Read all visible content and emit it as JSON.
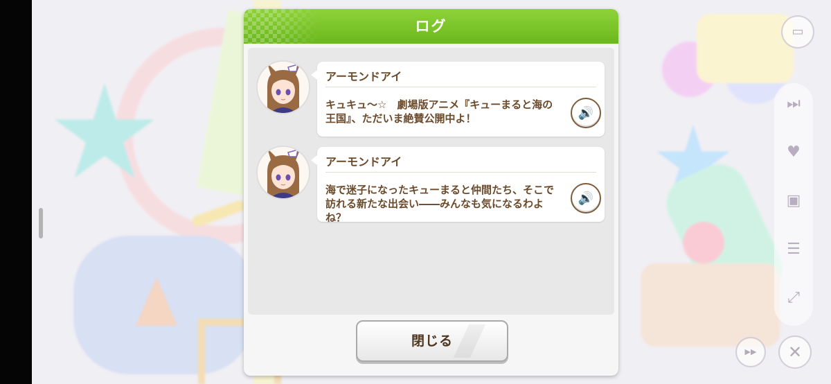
{
  "dialog": {
    "title": "ログ",
    "close_label": "閉じる"
  },
  "entries": [
    {
      "speaker": "アーモンドアイ",
      "text": "キュキュ〜☆　劇場版アニメ『キューまると海の王国』、ただいま絶賛公開中よ！"
    },
    {
      "speaker": "アーモンドアイ",
      "text": "海で迷子になったキューまると仲間たち、そこで訪れる新たな出会い――みんなも気になるわよね？"
    }
  ],
  "side_controls": {
    "top_icon": "background-toggle-icon",
    "menu_items": [
      "skip-icon",
      "heart-icon",
      "photo-icon",
      "log-icon",
      "fullscreen-icon"
    ],
    "auto_icon": "auto-icon",
    "close_icon": "close-icon"
  },
  "colors": {
    "header_green": "#7cc42a",
    "text_brown": "#6a4a2a"
  }
}
